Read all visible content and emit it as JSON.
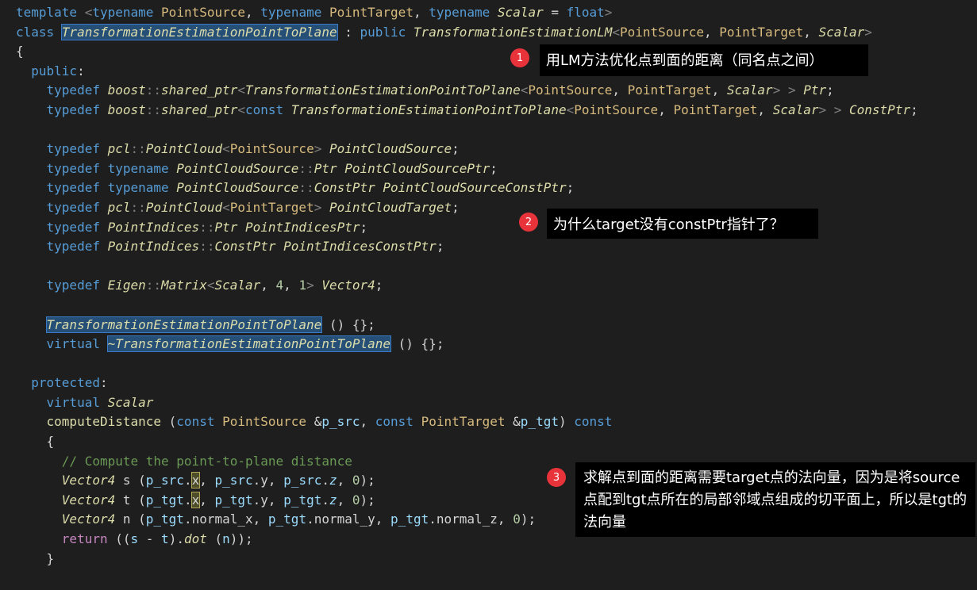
{
  "code_lines": [
    [
      {
        "c": "k",
        "t": "template "
      },
      {
        "c": "g",
        "t": "<"
      },
      {
        "c": "k",
        "t": "typename "
      },
      {
        "c": "ty",
        "t": "PointSource"
      },
      {
        "c": "p",
        "t": ", "
      },
      {
        "c": "k",
        "t": "typename "
      },
      {
        "c": "ty",
        "t": "PointTarget"
      },
      {
        "c": "p",
        "t": ", "
      },
      {
        "c": "k",
        "t": "typename "
      },
      {
        "c": "ti",
        "t": "Scalar"
      },
      {
        "c": "p",
        "t": " = "
      },
      {
        "c": "k",
        "t": "float"
      },
      {
        "c": "g",
        "t": ">"
      }
    ],
    [
      {
        "c": "k",
        "t": "class "
      },
      {
        "c": "ti sel",
        "t": "TransformationEstimationPointToPlane"
      },
      {
        "c": "p",
        "t": " : "
      },
      {
        "c": "k",
        "t": "public "
      },
      {
        "c": "ti",
        "t": "TransformationEstimationLM"
      },
      {
        "c": "g",
        "t": "<"
      },
      {
        "c": "ty",
        "t": "PointSource"
      },
      {
        "c": "p",
        "t": ", "
      },
      {
        "c": "ty",
        "t": "PointTarget"
      },
      {
        "c": "p",
        "t": ", "
      },
      {
        "c": "ti",
        "t": "Scalar"
      },
      {
        "c": "g",
        "t": ">"
      }
    ],
    [
      {
        "c": "p",
        "t": "{"
      }
    ],
    [
      {
        "c": "k",
        "t": "  public"
      },
      {
        "c": "p",
        "t": ":"
      }
    ],
    [
      {
        "c": "k",
        "t": "    typedef "
      },
      {
        "c": "ti",
        "t": "boost"
      },
      {
        "c": "g",
        "t": "::"
      },
      {
        "c": "ti",
        "t": "shared_ptr"
      },
      {
        "c": "g",
        "t": "<"
      },
      {
        "c": "ti",
        "t": "TransformationEstimationPointToPlane"
      },
      {
        "c": "g",
        "t": "<"
      },
      {
        "c": "ty",
        "t": "PointSource"
      },
      {
        "c": "p",
        "t": ", "
      },
      {
        "c": "ty",
        "t": "PointTarget"
      },
      {
        "c": "p",
        "t": ", "
      },
      {
        "c": "ti",
        "t": "Scalar"
      },
      {
        "c": "g",
        "t": "> > "
      },
      {
        "c": "ti",
        "t": "Ptr"
      },
      {
        "c": "p",
        "t": ";"
      }
    ],
    [
      {
        "c": "k",
        "t": "    typedef "
      },
      {
        "c": "ti",
        "t": "boost"
      },
      {
        "c": "g",
        "t": "::"
      },
      {
        "c": "ti",
        "t": "shared_ptr"
      },
      {
        "c": "g",
        "t": "<"
      },
      {
        "c": "k",
        "t": "const "
      },
      {
        "c": "ti",
        "t": "TransformationEstimationPointToPlane"
      },
      {
        "c": "g",
        "t": "<"
      },
      {
        "c": "ty",
        "t": "PointSource"
      },
      {
        "c": "p",
        "t": ", "
      },
      {
        "c": "ty",
        "t": "PointTarget"
      },
      {
        "c": "p",
        "t": ", "
      },
      {
        "c": "ti",
        "t": "Scalar"
      },
      {
        "c": "g",
        "t": "> > "
      },
      {
        "c": "ti",
        "t": "ConstPtr"
      },
      {
        "c": "p",
        "t": ";"
      }
    ],
    [
      {
        "c": "p",
        "t": ""
      }
    ],
    [
      {
        "c": "k",
        "t": "    typedef "
      },
      {
        "c": "ti",
        "t": "pcl"
      },
      {
        "c": "g",
        "t": "::"
      },
      {
        "c": "ti",
        "t": "PointCloud"
      },
      {
        "c": "g",
        "t": "<"
      },
      {
        "c": "ty",
        "t": "PointSource"
      },
      {
        "c": "g",
        "t": "> "
      },
      {
        "c": "ti",
        "t": "PointCloudSource"
      },
      {
        "c": "p",
        "t": ";"
      }
    ],
    [
      {
        "c": "k",
        "t": "    typedef typename "
      },
      {
        "c": "ti",
        "t": "PointCloudSource"
      },
      {
        "c": "g",
        "t": "::"
      },
      {
        "c": "ti",
        "t": "Ptr PointCloudSourcePtr"
      },
      {
        "c": "p",
        "t": ";"
      }
    ],
    [
      {
        "c": "k",
        "t": "    typedef typename "
      },
      {
        "c": "ti",
        "t": "PointCloudSource"
      },
      {
        "c": "g",
        "t": "::"
      },
      {
        "c": "ti",
        "t": "ConstPtr PointCloudSourceConstPtr"
      },
      {
        "c": "p",
        "t": ";"
      }
    ],
    [
      {
        "c": "k",
        "t": "    typedef "
      },
      {
        "c": "ti",
        "t": "pcl"
      },
      {
        "c": "g",
        "t": "::"
      },
      {
        "c": "ti",
        "t": "PointCloud"
      },
      {
        "c": "g",
        "t": "<"
      },
      {
        "c": "ty",
        "t": "PointTarget"
      },
      {
        "c": "g",
        "t": "> "
      },
      {
        "c": "ti",
        "t": "PointCloudTarget"
      },
      {
        "c": "p",
        "t": ";"
      }
    ],
    [
      {
        "c": "k",
        "t": "    typedef "
      },
      {
        "c": "ti",
        "t": "PointIndices"
      },
      {
        "c": "g",
        "t": "::"
      },
      {
        "c": "ti",
        "t": "Ptr PointIndicesPtr"
      },
      {
        "c": "p",
        "t": ";"
      }
    ],
    [
      {
        "c": "k",
        "t": "    typedef "
      },
      {
        "c": "ti",
        "t": "PointIndices"
      },
      {
        "c": "g",
        "t": "::"
      },
      {
        "c": "ti",
        "t": "ConstPtr PointIndicesConstPtr"
      },
      {
        "c": "p",
        "t": ";"
      }
    ],
    [
      {
        "c": "p",
        "t": ""
      }
    ],
    [
      {
        "c": "k",
        "t": "    typedef "
      },
      {
        "c": "ti",
        "t": "Eigen"
      },
      {
        "c": "g",
        "t": "::"
      },
      {
        "c": "ti",
        "t": "Matrix"
      },
      {
        "c": "g",
        "t": "<"
      },
      {
        "c": "ti",
        "t": "Scalar"
      },
      {
        "c": "p",
        "t": ", "
      },
      {
        "c": "n",
        "t": "4"
      },
      {
        "c": "p",
        "t": ", "
      },
      {
        "c": "n",
        "t": "1"
      },
      {
        "c": "g",
        "t": "> "
      },
      {
        "c": "ti",
        "t": "Vector4"
      },
      {
        "c": "p",
        "t": ";"
      }
    ],
    [
      {
        "c": "p",
        "t": ""
      }
    ],
    [
      {
        "c": "p",
        "t": "    "
      },
      {
        "c": "ti sel",
        "t": "TransformationEstimationPointToPlane"
      },
      {
        "c": "p",
        "t": " () {};"
      }
    ],
    [
      {
        "c": "k",
        "t": "    virtual "
      },
      {
        "c": "ti sel",
        "t": "~TransformationEstimationPointToPlane"
      },
      {
        "c": "p",
        "t": " () {};"
      }
    ],
    [
      {
        "c": "p",
        "t": ""
      }
    ],
    [
      {
        "c": "k",
        "t": "  protected"
      },
      {
        "c": "p",
        "t": ":"
      }
    ],
    [
      {
        "c": "k",
        "t": "    virtual "
      },
      {
        "c": "ti",
        "t": "Scalar"
      }
    ],
    [
      {
        "c": "fn",
        "t": "    computeDistance "
      },
      {
        "c": "p",
        "t": "("
      },
      {
        "c": "k",
        "t": "const "
      },
      {
        "c": "ty",
        "t": "PointSource "
      },
      {
        "c": "p",
        "t": "&"
      },
      {
        "c": "v",
        "t": "p_src"
      },
      {
        "c": "p",
        "t": ", "
      },
      {
        "c": "k",
        "t": "const "
      },
      {
        "c": "ty",
        "t": "PointTarget "
      },
      {
        "c": "p",
        "t": "&"
      },
      {
        "c": "v",
        "t": "p_tgt"
      },
      {
        "c": "p",
        "t": ") "
      },
      {
        "c": "k",
        "t": "const"
      }
    ],
    [
      {
        "c": "p",
        "t": "    {"
      }
    ],
    [
      {
        "c": "c",
        "t": "      // Compute the point-to-plane distance"
      }
    ],
    [
      {
        "c": "p",
        "t": "      "
      },
      {
        "c": "ti",
        "t": "Vector4"
      },
      {
        "c": "p",
        "t": " s ("
      },
      {
        "c": "v",
        "t": "p_src"
      },
      {
        "c": "p",
        "t": "."
      },
      {
        "c": "p hl",
        "t": "x"
      },
      {
        "c": "p",
        "t": ", "
      },
      {
        "c": "v",
        "t": "p_src"
      },
      {
        "c": "p",
        "t": ".y, "
      },
      {
        "c": "v",
        "t": "p_src"
      },
      {
        "c": "p",
        "t": "."
      },
      {
        "c": "vi",
        "t": "z"
      },
      {
        "c": "p",
        "t": ", "
      },
      {
        "c": "n",
        "t": "0"
      },
      {
        "c": "p",
        "t": ");"
      }
    ],
    [
      {
        "c": "p",
        "t": "      "
      },
      {
        "c": "ti",
        "t": "Vector4"
      },
      {
        "c": "p",
        "t": " t ("
      },
      {
        "c": "v",
        "t": "p_tgt"
      },
      {
        "c": "p",
        "t": "."
      },
      {
        "c": "p hl",
        "t": "x"
      },
      {
        "c": "p",
        "t": ", "
      },
      {
        "c": "v",
        "t": "p_tgt"
      },
      {
        "c": "p",
        "t": ".y, "
      },
      {
        "c": "v",
        "t": "p_tgt"
      },
      {
        "c": "p",
        "t": "."
      },
      {
        "c": "vi",
        "t": "z"
      },
      {
        "c": "p",
        "t": ", "
      },
      {
        "c": "n",
        "t": "0"
      },
      {
        "c": "p",
        "t": ");"
      }
    ],
    [
      {
        "c": "p",
        "t": "      "
      },
      {
        "c": "ti",
        "t": "Vector4"
      },
      {
        "c": "p",
        "t": " n ("
      },
      {
        "c": "v",
        "t": "p_tgt"
      },
      {
        "c": "p",
        "t": ".normal_x, "
      },
      {
        "c": "v",
        "t": "p_tgt"
      },
      {
        "c": "p",
        "t": ".normal_y, "
      },
      {
        "c": "v",
        "t": "p_tgt"
      },
      {
        "c": "p",
        "t": ".normal_z, "
      },
      {
        "c": "n",
        "t": "0"
      },
      {
        "c": "p",
        "t": ");"
      }
    ],
    [
      {
        "c": "ks",
        "t": "      return "
      },
      {
        "c": "p",
        "t": "(("
      },
      {
        "c": "v",
        "t": "s"
      },
      {
        "c": "p",
        "t": " - "
      },
      {
        "c": "v",
        "t": "t"
      },
      {
        "c": "p",
        "t": ")."
      },
      {
        "c": "m",
        "t": "dot"
      },
      {
        "c": "p",
        "t": " ("
      },
      {
        "c": "v",
        "t": "n"
      },
      {
        "c": "p",
        "t": "));"
      }
    ],
    [
      {
        "c": "p",
        "t": "    }"
      }
    ]
  ],
  "annotations": [
    {
      "number": "1",
      "text": "用LM方法优化点到面的距离（同名点之间）"
    },
    {
      "number": "2",
      "text": "为什么target没有constPtr指针了？"
    },
    {
      "number": "3",
      "text": "求解点到面的距离需要target点的法向量，因为是将source点配到tgt点所在的局部邻域点组成的切平面上，所以是tgt的法向量"
    }
  ]
}
